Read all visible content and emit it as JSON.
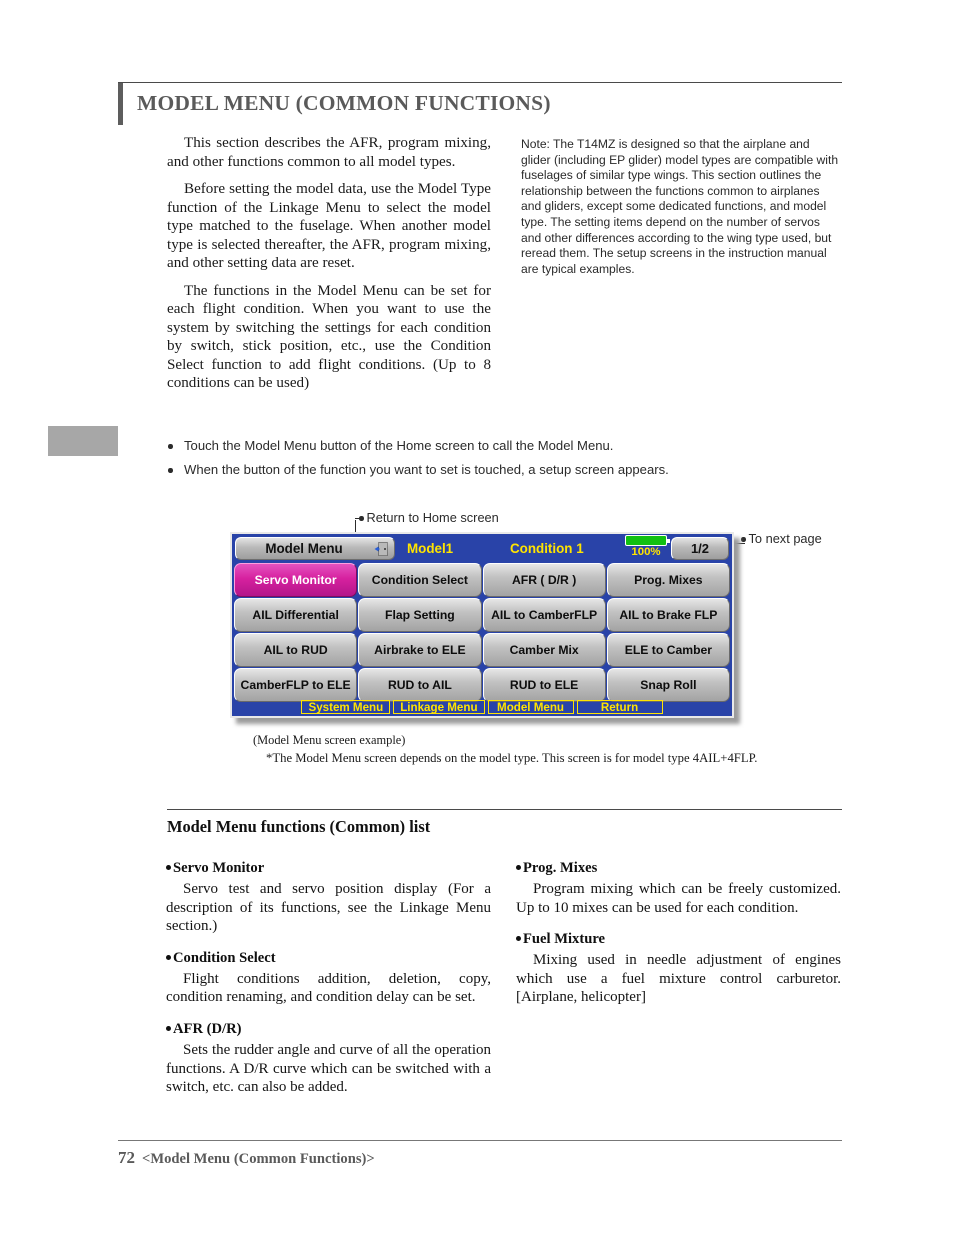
{
  "page": {
    "title": "MODEL MENU (COMMON FUNCTIONS)",
    "footer_number": "72",
    "footer_text": "<Model Menu (Common Functions)>"
  },
  "intro": {
    "paragraphs": [
      "This section describes the AFR, program mixing, and other functions common to all model types.",
      "Before setting the model data, use the Model Type function of the Linkage Menu to select the model type matched to the fuselage. When another model type is selected thereafter, the AFR, program mixing, and other setting data are reset.",
      "The functions in the Model Menu can be set for each flight condition. When you want to use the system by switching the settings for each condition by switch, stick position, etc., use the Condition Select function to add flight conditions. (Up to 8 conditions can be used)"
    ],
    "note": "Note: The T14MZ is designed so that the airplane and glider (including EP glider) model types are compatible with fuselages of similar type wings. This section outlines the relationship between the functions common to airplanes and gliders, except some dedicated functions, and model type. The setting items depend on the number of servos and other differences according to the wing type used, but reread them. The setup screens in the instruction manual are typical examples."
  },
  "bullets": [
    "Touch the Model Menu button of the Home screen to call the Model Menu.",
    "When the button of the function you want to set is touched, a setup screen appears."
  ],
  "callouts": {
    "home": "Return to Home screen",
    "next_page": "To next page"
  },
  "lcd": {
    "header": {
      "menu_button": "Model Menu",
      "home_icon": "door-exit-icon",
      "model_name": "Model1",
      "condition": "Condition 1",
      "battery_icon": "battery-full-icon",
      "battery_percent": "100%",
      "page_indicator": "1/2"
    },
    "buttons": [
      {
        "label": "Servo Monitor",
        "selected": true
      },
      {
        "label": "Condition Select",
        "selected": false
      },
      {
        "label": "AFR ( D/R )",
        "selected": false
      },
      {
        "label": "Prog. Mixes",
        "selected": false
      },
      {
        "label": "AIL Differential",
        "selected": false
      },
      {
        "label": "Flap Setting",
        "selected": false
      },
      {
        "label": "AIL to CamberFLP",
        "selected": false
      },
      {
        "label": "AIL to Brake FLP",
        "selected": false
      },
      {
        "label": "AIL to RUD",
        "selected": false
      },
      {
        "label": "Airbrake to ELE",
        "selected": false
      },
      {
        "label": "Camber Mix",
        "selected": false
      },
      {
        "label": "ELE to Camber",
        "selected": false
      },
      {
        "label": "CamberFLP to ELE",
        "selected": false
      },
      {
        "label": "RUD to AIL",
        "selected": false
      },
      {
        "label": "RUD to ELE",
        "selected": false
      },
      {
        "label": "Snap Roll",
        "selected": false
      }
    ],
    "nav": [
      "System Menu",
      "Linkage Menu",
      "Model Menu",
      "Return"
    ],
    "colors": {
      "screen_background": "#2943a8",
      "accent_yellow": "#ffe400",
      "selected_button": "#d6219f",
      "battery_green": "#12c012"
    }
  },
  "captions": {
    "example": "(Model Menu screen example)",
    "note": "*The Model Menu screen depends on the model type. This screen is for model type 4AIL+4FLP."
  },
  "functions_list": {
    "title": "Model Menu functions (Common) list",
    "left": [
      {
        "name": "Servo Monitor",
        "description": "Servo test and servo position display (For a description of its functions, see the Linkage Menu section.)"
      },
      {
        "name": "Condition Select",
        "description": "Flight conditions addition, deletion, copy, condition renaming, and condition delay can be set."
      },
      {
        "name": "AFR (D/R)",
        "description": "Sets the rudder angle and curve of all the operation functions. A D/R curve which can be switched with a switch, etc. can also be added."
      }
    ],
    "right": [
      {
        "name": "Prog. Mixes",
        "description": "Program mixing which can be freely customized. Up to 10 mixes can be used for each condition."
      },
      {
        "name": "Fuel Mixture",
        "description": "Mixing used in needle adjustment of engines which use a fuel mixture control carburetor. [Airplane, helicopter]"
      }
    ]
  }
}
